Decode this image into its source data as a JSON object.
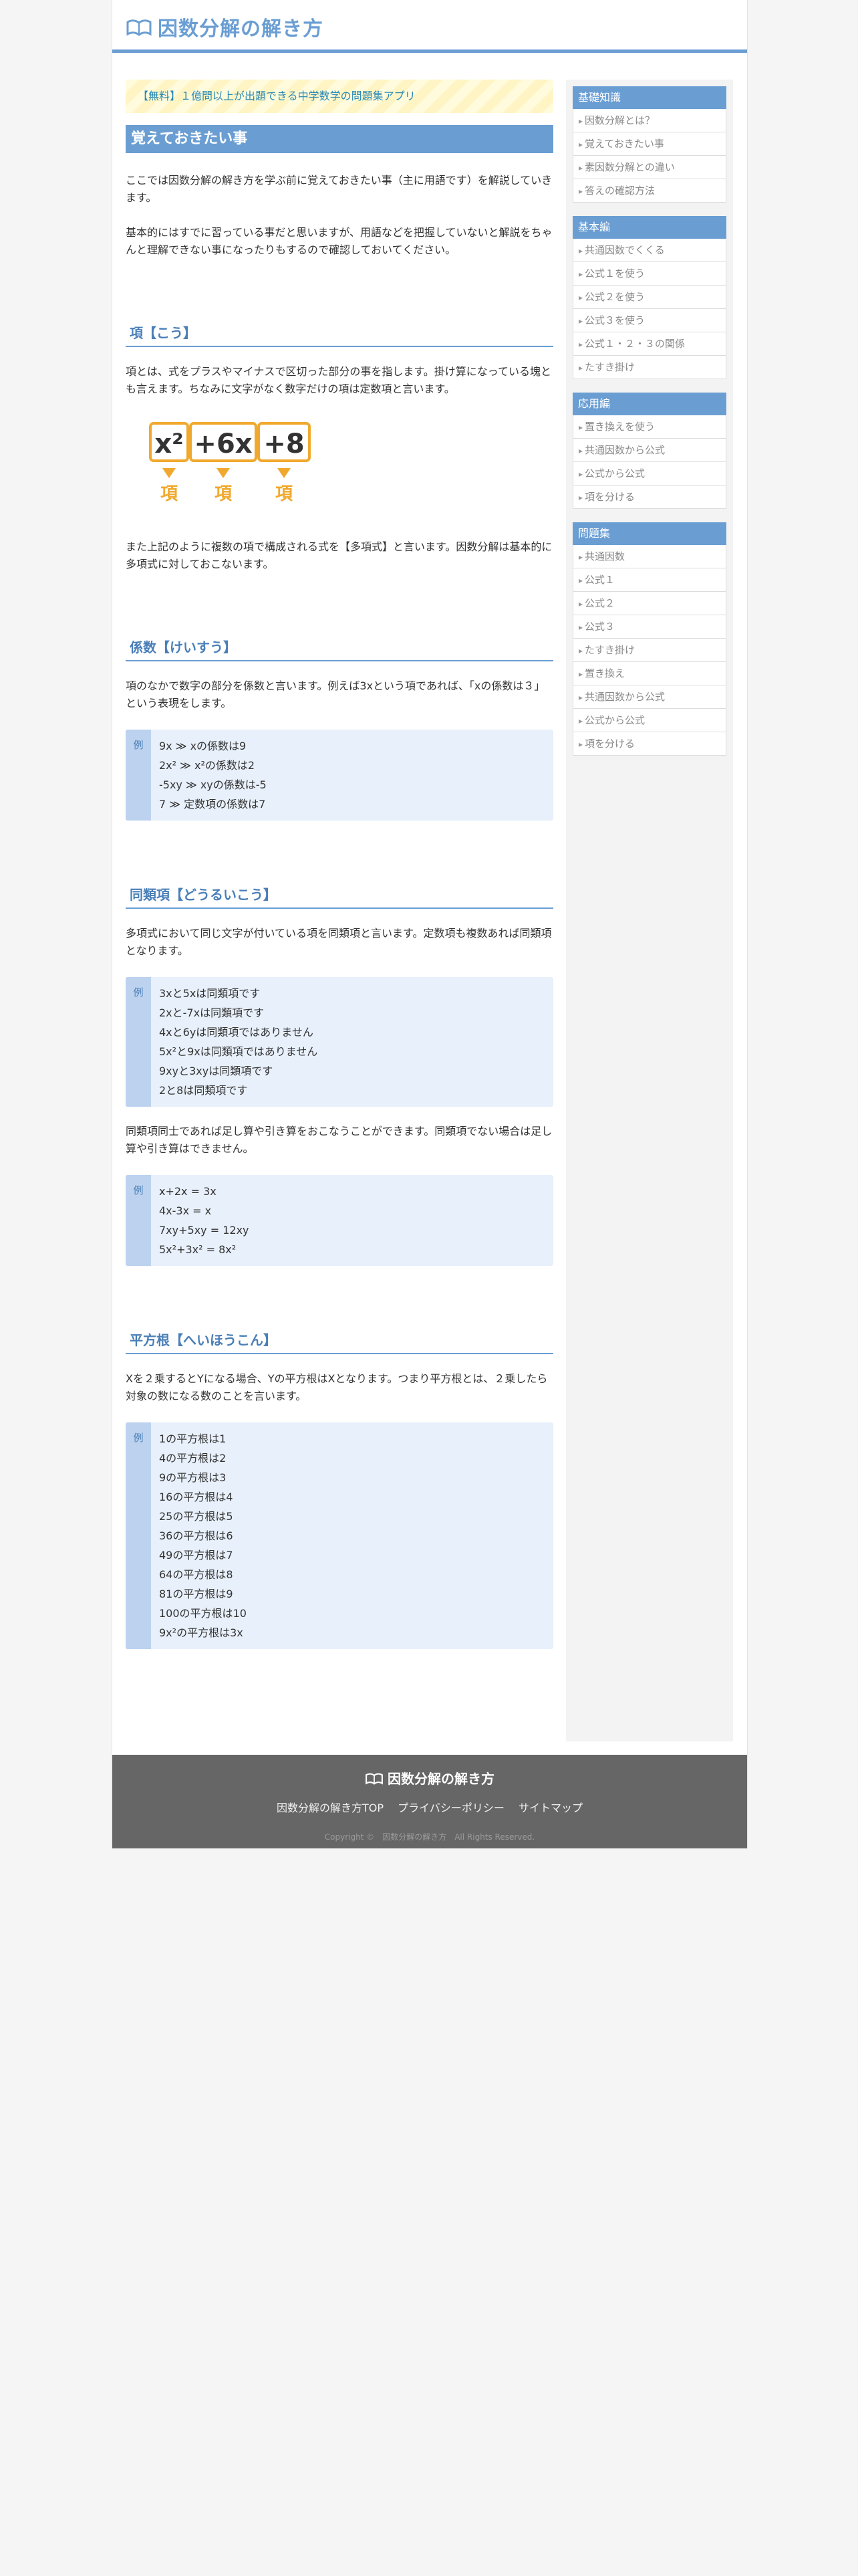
{
  "site": {
    "title": "因数分解の解き方"
  },
  "promo": {
    "text": "【無料】１億問以上が出題できる中学数学の問題集アプリ"
  },
  "main": {
    "heading": "覚えておきたい事",
    "intro1": "ここでは因数分解の解き方を学ぶ前に覚えておきたい事（主に用語です）を解説していきます。",
    "intro2": "基本的にはすでに習っている事だと思いますが、用語などを把握していないと解説をちゃんと理解できない事になったりもするので確認しておいてください。",
    "sections": {
      "kou": {
        "title": "項【こう】",
        "text1": "項とは、式をプラスやマイナスで区切った部分の事を指します。掛け算になっている塊とも言えます。ちなみに文字がなく数字だけの項は定数項と言います。",
        "figure": {
          "terms": [
            "x²",
            "+6x",
            "+8"
          ],
          "label": "項"
        },
        "text2": "また上記のように複数の項で構成される式を【多項式】と言います。因数分解は基本的に多項式に対しておこないます。"
      },
      "keisu": {
        "title": "係数【けいすう】",
        "text": "項のなかで数字の部分を係数と言います。例えば3xという項であれば、「xの係数は３」という表現をします。",
        "example_tag": "例",
        "examples": [
          "9x ≫ xの係数は9",
          "2x² ≫ x²の係数は2",
          "-5xy ≫ xyの係数は-5",
          "7 ≫ 定数項の係数は7"
        ]
      },
      "douruikou": {
        "title": "同類項【どうるいこう】",
        "text1": "多項式において同じ文字が付いている項を同類項と言います。定数項も複数あれば同類項となります。",
        "example_tag": "例",
        "examples1": [
          "3xと5xは同類項です",
          "2xと-7xは同類項です",
          "4xと6yは同類項ではありません",
          "5x²と9xは同類項ではありません",
          "9xyと3xyは同類項です",
          "2と8は同類項です"
        ],
        "text2": "同類項同士であれば足し算や引き算をおこなうことができます。同類項でない場合は足し算や引き算はできません。",
        "examples2": [
          "x+2x = 3x",
          "4x-3x = x",
          "7xy+5xy = 12xy",
          "5x²+3x² = 8x²"
        ]
      },
      "heihoukon": {
        "title": "平方根【へいほうこん】",
        "text": "Xを２乗するとYになる場合、Yの平方根はXとなります。つまり平方根とは、２乗したら対象の数になる数のことを言います。",
        "example_tag": "例",
        "examples": [
          "1の平方根は1",
          "4の平方根は2",
          "9の平方根は3",
          "16の平方根は4",
          "25の平方根は5",
          "36の平方根は6",
          "49の平方根は7",
          "64の平方根は8",
          "81の平方根は9",
          "100の平方根は10",
          "9x²の平方根は3x"
        ]
      }
    }
  },
  "sidebar": [
    {
      "title": "基礎知識",
      "items": [
        "因数分解とは？",
        "覚えておきたい事",
        "素因数分解との違い",
        "答えの確認方法"
      ]
    },
    {
      "title": "基本編",
      "items": [
        "共通因数でくくる",
        "公式１を使う",
        "公式２を使う",
        "公式３を使う",
        "公式１・２・３の関係",
        "たすき掛け"
      ]
    },
    {
      "title": "応用編",
      "items": [
        "置き換えを使う",
        "共通因数から公式",
        "公式から公式",
        "項を分ける"
      ]
    },
    {
      "title": "問題集",
      "items": [
        "共通因数",
        "公式１",
        "公式２",
        "公式３",
        "たすき掛け",
        "置き換え",
        "共通因数から公式",
        "公式から公式",
        "項を分ける"
      ]
    }
  ],
  "footer": {
    "title": "因数分解の解き方",
    "links": [
      "因数分解の解き方TOP",
      "プライバシーポリシー",
      "サイトマップ"
    ],
    "copyright": "Copyright ©　因数分解の解き方　All Rights Reserved."
  },
  "colors": {
    "accent": "#6a9ed3",
    "example_bg": "#e8f0fb",
    "term_orange": "#f0a92e",
    "footer_bg": "#666666"
  }
}
